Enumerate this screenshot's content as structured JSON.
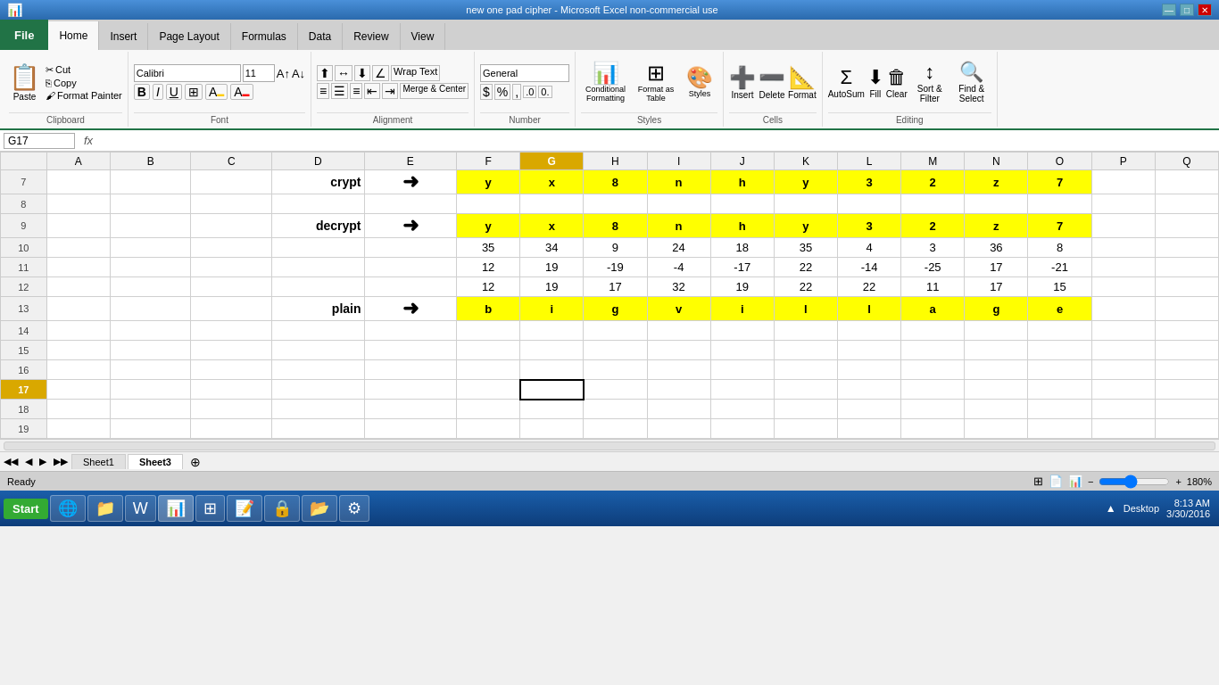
{
  "titlebar": {
    "title": "new one pad cipher - Microsoft Excel non-commercial use",
    "controls": [
      "—",
      "□",
      "✕"
    ]
  },
  "tabs": [
    "File",
    "Home",
    "Insert",
    "Page Layout",
    "Formulas",
    "Data",
    "Review",
    "View"
  ],
  "active_tab": "Home",
  "ribbon": {
    "clipboard_label": "Clipboard",
    "font_label": "Font",
    "alignment_label": "Alignment",
    "number_label": "Number",
    "styles_label": "Styles",
    "cells_label": "Cells",
    "editing_label": "Editing",
    "paste_label": "Paste",
    "cut_label": "Cut",
    "copy_label": "Copy",
    "format_painter_label": "Format Painter",
    "font_name": "Calibri",
    "font_size": "11",
    "bold": "B",
    "italic": "I",
    "underline": "U",
    "wrap_text": "Wrap Text",
    "merge_center": "Merge & Center",
    "number_format": "General",
    "conditional_formatting": "Conditional Formatting",
    "format_as_table": "Format as Table",
    "cell_styles": "Cell Styles",
    "insert_label": "Insert",
    "delete_label": "Delete",
    "format_label": "Format",
    "autosum": "AutoSum",
    "fill": "Fill",
    "clear": "Clear",
    "sort_filter": "Sort & Filter",
    "find_select": "Find & Select",
    "styles_group_label": "Styles"
  },
  "formula_bar": {
    "name_box": "G17",
    "fx": "fx",
    "formula": ""
  },
  "columns": [
    "",
    "A",
    "B",
    "C",
    "D",
    "E",
    "F",
    "G",
    "H",
    "I",
    "J",
    "K",
    "L",
    "M",
    "N",
    "O",
    "P",
    "Q"
  ],
  "rows": {
    "7": {
      "D": "crypt",
      "E_arrow": "→",
      "F": "y",
      "G": "x",
      "H": "8",
      "I": "n",
      "J": "h",
      "K": "y",
      "L": "3",
      "M": "2",
      "N": "z",
      "O": "7",
      "yellow": true
    },
    "8": {},
    "9": {
      "D": "decrypt",
      "E_arrow": "→",
      "F": "y",
      "G": "x",
      "H": "8",
      "I": "n",
      "J": "h",
      "K": "y",
      "L": "3",
      "M": "2",
      "N": "z",
      "O": "7",
      "yellow": true
    },
    "10": {
      "F": "35",
      "G": "34",
      "H": "9",
      "I": "24",
      "J": "18",
      "K": "35",
      "L": "4",
      "M": "3",
      "N": "36",
      "O": "8"
    },
    "11": {
      "F": "12",
      "G": "19",
      "H": "-19",
      "I": "-4",
      "J": "-17",
      "K": "22",
      "L": "-14",
      "M": "-25",
      "N": "17",
      "O": "-21"
    },
    "12": {
      "F": "12",
      "G": "19",
      "H": "17",
      "I": "32",
      "J": "19",
      "K": "22",
      "L": "22",
      "M": "11",
      "N": "17",
      "O": "15"
    },
    "13": {
      "D": "plain",
      "E_arrow": "→",
      "F": "b",
      "G": "i",
      "H": "g",
      "I": "v",
      "J": "i",
      "K": "l",
      "L": "l",
      "M": "a",
      "N": "g",
      "O": "e",
      "yellow": true
    },
    "14": {},
    "15": {},
    "16": {},
    "17": {
      "G_selected": true
    },
    "18": {},
    "19": {}
  },
  "selected_cell": "G17",
  "selected_col": "G",
  "sheets": [
    "Sheet1",
    "Sheet3"
  ],
  "active_sheet": "Sheet3",
  "status": {
    "ready": "Ready",
    "zoom": "180%"
  },
  "taskbar": {
    "start": "Start",
    "time": "8:13 AM",
    "date": "3/30/2016",
    "desktop": "Desktop"
  }
}
